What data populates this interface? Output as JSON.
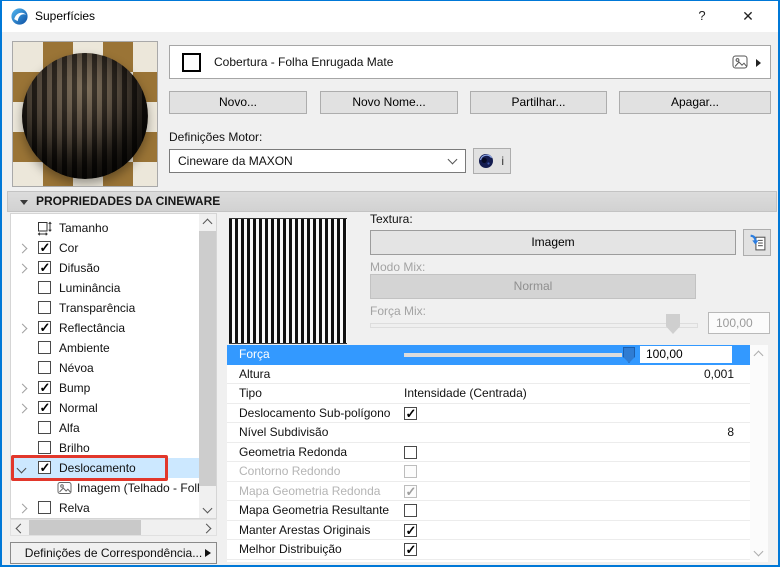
{
  "colors": {
    "window_border": "#0078d7",
    "selected_row": "#3399ff",
    "tree_selection": "#cce8ff",
    "annotation_red": "#e2372b"
  },
  "titlebar": {
    "title": "Superfícies",
    "help": "?",
    "close": "✕"
  },
  "material": {
    "name": "Cobertura - Folha Enrugada Mate"
  },
  "actions": {
    "new": "Novo...",
    "rename": "Novo Nome...",
    "share": "Partilhar...",
    "delete": "Apagar..."
  },
  "engine": {
    "label": "Definições Motor:",
    "selected": "Cineware da MAXON",
    "info": "i"
  },
  "section": {
    "title": "PROPRIEDADES DA CINEWARE"
  },
  "tree": {
    "items": [
      {
        "label": "Tamanho",
        "icon": "size-icon",
        "checkbox": null,
        "expander": null
      },
      {
        "label": "Cor",
        "checkbox": true,
        "expander": "collapsed"
      },
      {
        "label": "Difusão",
        "checkbox": true,
        "expander": "collapsed"
      },
      {
        "label": "Luminância",
        "checkbox": false,
        "expander": null
      },
      {
        "label": "Transparência",
        "checkbox": false,
        "expander": null
      },
      {
        "label": "Reflectância",
        "checkbox": true,
        "expander": "collapsed"
      },
      {
        "label": "Ambiente",
        "checkbox": false,
        "expander": null
      },
      {
        "label": "Névoa",
        "checkbox": false,
        "expander": null
      },
      {
        "label": "Bump",
        "checkbox": true,
        "expander": "collapsed"
      },
      {
        "label": "Normal",
        "checkbox": true,
        "expander": "collapsed"
      },
      {
        "label": "Alfa",
        "checkbox": false,
        "expander": null
      },
      {
        "label": "Brilho",
        "checkbox": false,
        "expander": null
      },
      {
        "label": "Deslocamento",
        "checkbox": true,
        "expander": "expanded",
        "selected": true,
        "annotated": true
      },
      {
        "label": "Imagem (Telhado - Folha C",
        "icon": "image-icon",
        "child": true
      },
      {
        "label": "Relva",
        "checkbox": false,
        "expander": "collapsed"
      }
    ]
  },
  "tree_footer": {
    "matching_button": "Definições de Correspondência..."
  },
  "texture": {
    "label": "Textura:",
    "button": "Imagem",
    "mix_mode_label": "Modo Mix:",
    "mix_mode_value": "Normal",
    "mix_strength_label": "Força Mix:",
    "mix_strength_value": "100,00"
  },
  "properties": {
    "rows": [
      {
        "label": "Força",
        "type": "slider",
        "value": "100,00",
        "selected": true
      },
      {
        "label": "Altura",
        "type": "number",
        "value": "0,001"
      },
      {
        "label": "Tipo",
        "type": "text",
        "value": "Intensidade (Centrada)"
      },
      {
        "label": "Deslocamento Sub-polígono",
        "type": "checkbox",
        "checked": true
      },
      {
        "label": "Nível Subdivisão",
        "type": "number",
        "value": "8"
      },
      {
        "label": "Geometria Redonda",
        "type": "checkbox",
        "checked": false
      },
      {
        "label": "Contorno Redondo",
        "type": "checkbox",
        "checked": false,
        "disabled": true
      },
      {
        "label": "Mapa Geometria Redonda",
        "type": "checkbox",
        "checked": true,
        "disabled": true
      },
      {
        "label": "Mapa Geometria Resultante",
        "type": "checkbox",
        "checked": false
      },
      {
        "label": "Manter Arestas Originais",
        "type": "checkbox",
        "checked": true
      },
      {
        "label": "Melhor Distribuição",
        "type": "checkbox",
        "checked": true
      }
    ]
  }
}
